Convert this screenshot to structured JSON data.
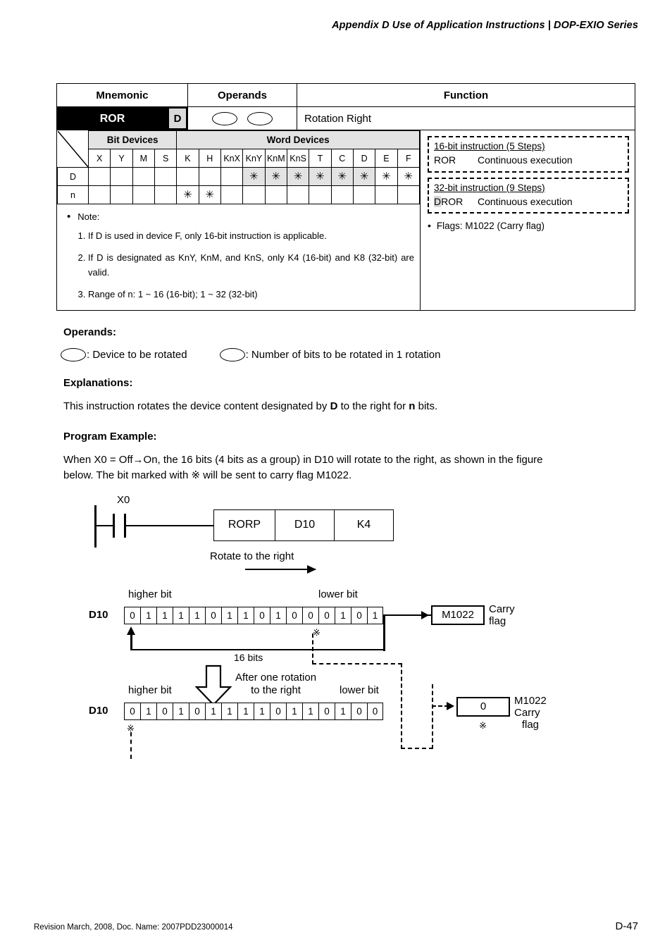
{
  "header": {
    "title": "Appendix D Use of Application Instructions | DOP-EXIO Series"
  },
  "footer": {
    "revision": "Revision March, 2008, Doc. Name: 2007PDD23000014",
    "page": "D-47"
  },
  "summary_table": {
    "headers": [
      "Mnemonic",
      "Operands",
      "Function"
    ],
    "mnemonic": "ROR",
    "d_flag": "D",
    "function": "Rotation Right"
  },
  "device_table": {
    "group_headers": [
      "Bit Devices",
      "Word Devices"
    ],
    "columns": [
      "X",
      "Y",
      "M",
      "S",
      "K",
      "H",
      "KnX",
      "KnY",
      "KnM",
      "KnS",
      "T",
      "C",
      "D",
      "E",
      "F"
    ],
    "star": "✳",
    "rows": [
      {
        "label": "D",
        "marks": [
          "",
          "",
          "",
          "",
          "",
          "",
          "",
          "*",
          "*",
          "*",
          "*",
          "*",
          "*",
          "*",
          "*"
        ],
        "shaded": [
          false,
          false,
          false,
          false,
          false,
          false,
          false,
          true,
          true,
          true,
          true,
          true,
          true,
          false,
          false
        ]
      },
      {
        "label": "n",
        "marks": [
          "",
          "",
          "",
          "",
          "*",
          "*",
          "",
          "",
          "",
          "",
          "",
          "",
          "",
          "",
          ""
        ],
        "shaded": [
          false,
          false,
          false,
          false,
          false,
          false,
          false,
          false,
          false,
          false,
          false,
          false,
          false,
          false,
          false
        ]
      }
    ]
  },
  "notes": {
    "title": "Note:",
    "items": [
      "If D is used in device F, only 16-bit instruction is applicable.",
      "If D is designated as KnY, KnM, and KnS, only K4 (16-bit) and K8 (32-bit) are valid.",
      "Range of n: 1 ~ 16 (16-bit); 1 ~ 32 (32-bit)"
    ]
  },
  "instructions": {
    "bit16": {
      "title": "16-bit instruction (5 Steps)",
      "mnemonic": "ROR",
      "execution": "Continuous execution"
    },
    "bit32": {
      "title": "32-bit instruction (9 Steps)",
      "mnemonic_prefix": "D",
      "mnemonic_rest": "ROR",
      "execution": "Continuous execution"
    },
    "flags": "Flags: M1022 (Carry flag)"
  },
  "sections": {
    "operands_heading": "Operands:",
    "operand_d_desc": ": Device to be rotated",
    "operand_n_desc": ": Number of bits to be rotated in 1 rotation",
    "explanations_heading": "Explanations:",
    "explanation_text": "This instruction rotates the device content designated by D to the right for n bits.",
    "explanation_bold_1": "D",
    "explanation_bold_2": "n",
    "program_example_heading": "Program Example:",
    "program_example_line1": "When X0 = Off→On, the 16 bits (4 bits as a group) in D10 will rotate to the right, as shown in the figure",
    "program_example_line2": "below. The bit marked with ※ will be sent to carry flag M1022."
  },
  "figure": {
    "ladder": {
      "contact_label": "X0",
      "instruction": "RORP",
      "operand_d": "D10",
      "operand_n": "K4"
    },
    "rotate_label": "Rotate to the right",
    "higher_bit_label": "higher bit",
    "lower_bit_label": "lower bit",
    "bits_label": "16 bits",
    "after_rotation_line1": "After one rotation",
    "after_rotation_line2": "to the right",
    "refmark": "※",
    "row1": {
      "name": "D10",
      "bits": [
        "0",
        "1",
        "1",
        "1",
        "1",
        "0",
        "1",
        "1",
        "0",
        "1",
        "0",
        "0",
        "0",
        "1",
        "0",
        "1"
      ],
      "refmark_index": 12
    },
    "row2": {
      "name": "D10",
      "bits": [
        "0",
        "1",
        "0",
        "1",
        "0",
        "1",
        "1",
        "1",
        "1",
        "0",
        "1",
        "1",
        "0",
        "1",
        "0",
        "0"
      ],
      "refmark_index": 0
    },
    "carry_top": {
      "value": "M1022",
      "label_line1": "Carry",
      "label_line2": "flag"
    },
    "carry_bottom": {
      "value": "0",
      "label_line1": "M1022",
      "label_line2": "Carry",
      "label_line3": "flag"
    }
  }
}
